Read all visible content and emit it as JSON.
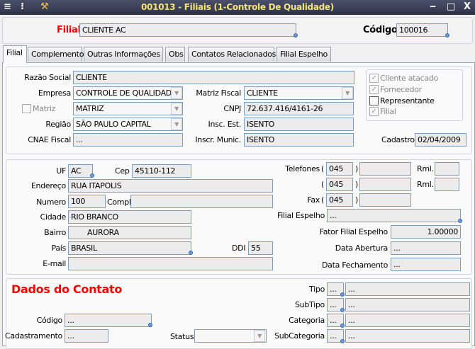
{
  "window": {
    "title": "001013 - Filiais (1-Controle De Qualidade)",
    "controls": {
      "minimize": "‒",
      "maximize": "□",
      "close": "X"
    }
  },
  "header": {
    "filial_label": "Filial",
    "filial_value": "CLIENTE AC",
    "codigo_label": "Código",
    "codigo_value": "100016"
  },
  "tabs": [
    {
      "label": "Filial",
      "active": true
    },
    {
      "label": "Complemento"
    },
    {
      "label": "Outras Informações"
    },
    {
      "label": "Obs"
    },
    {
      "label": "Contatos Relacionados"
    },
    {
      "label": "Filial Espelho"
    }
  ],
  "geral": {
    "razao_social": {
      "label": "Razão Social",
      "value": "CLIENTE"
    },
    "empresa": {
      "label": "Empresa",
      "value": "CONTROLE DE QUALIDADE"
    },
    "matriz_fiscal": {
      "label": "Matriz Fiscal",
      "value": "CLIENTE"
    },
    "matriz": {
      "label": "Matriz",
      "checked": false,
      "value": "MATRIZ"
    },
    "cnpj": {
      "label": "CNPJ",
      "value": "72.637.416/4161-26"
    },
    "regiao": {
      "label": "Região",
      "value": "SÃO PAULO CAPITAL"
    },
    "insc_est": {
      "label": "Insc. Est.",
      "value": "ISENTO"
    },
    "cnae": {
      "label": "CNAE Fiscal",
      "value": "..."
    },
    "insc_munic": {
      "label": "Inscr. Munic.",
      "value": "ISENTO"
    },
    "cadastro": {
      "label": "Cadastro",
      "value": "02/04/2009"
    },
    "flags": [
      {
        "label": "Cliente atacado",
        "checked": true
      },
      {
        "label": "Fornecedor",
        "checked": true
      },
      {
        "label": "Representante",
        "checked": false
      },
      {
        "label": "Filial",
        "checked": true
      }
    ]
  },
  "endereco": {
    "uf": {
      "label": "UF",
      "value": "AC"
    },
    "cep": {
      "label": "Cep",
      "value": "45110-112"
    },
    "endereco": {
      "label": "Endereço",
      "value": "RUA ITAPOLIS"
    },
    "numero": {
      "label": "Numero",
      "value": "100"
    },
    "compl": {
      "label": "Compl.",
      "value": ""
    },
    "cidade": {
      "label": "Cidade",
      "value": "RIO BRANCO"
    },
    "bairro": {
      "label": "Bairro",
      "value": "AURORA"
    },
    "pais": {
      "label": "País",
      "value": "BRASIL"
    },
    "ddi": {
      "label": "DDI",
      "value": "55"
    },
    "email": {
      "label": "E-mail",
      "value": ""
    },
    "telefones_label": "Telefones",
    "paren_open": "(",
    "paren_close": ")",
    "rml_label": "Rml.",
    "fax_label": "Fax",
    "tel1": {
      "ddd": "045",
      "numero": "",
      "ramal": ""
    },
    "tel2": {
      "ddd": "045",
      "numero": "",
      "ramal": ""
    },
    "fax": {
      "ddd": "045",
      "numero": ""
    },
    "filial_espelho": {
      "label": "Filial Espelho",
      "value": "..."
    },
    "fator": {
      "label": "Fator Filial Espelho",
      "value": "1.00000"
    },
    "data_abertura": {
      "label": "Data Abertura",
      "value": "..."
    },
    "data_fechamento": {
      "label": "Data Fechamento",
      "value": "..."
    }
  },
  "contato": {
    "title": "Dados do Contato",
    "codigo": {
      "label": "Código",
      "value": "..."
    },
    "cadastramento": {
      "label": "Cadastramento",
      "value": "..."
    },
    "status": {
      "label": "Status",
      "value": ""
    },
    "tipo": {
      "label": "Tipo",
      "code": "...",
      "desc": "..."
    },
    "subtipo": {
      "label": "SubTipo",
      "code": "...",
      "desc": "..."
    },
    "categoria": {
      "label": "Categoria",
      "code": "...",
      "desc": "..."
    },
    "subcategoria": {
      "label": "SubCategoria",
      "code": "...",
      "desc": "..."
    }
  },
  "colors": {
    "accent_red": "#ff0000",
    "title_text": "#f2e27a",
    "field_border": "#7f9db9"
  }
}
